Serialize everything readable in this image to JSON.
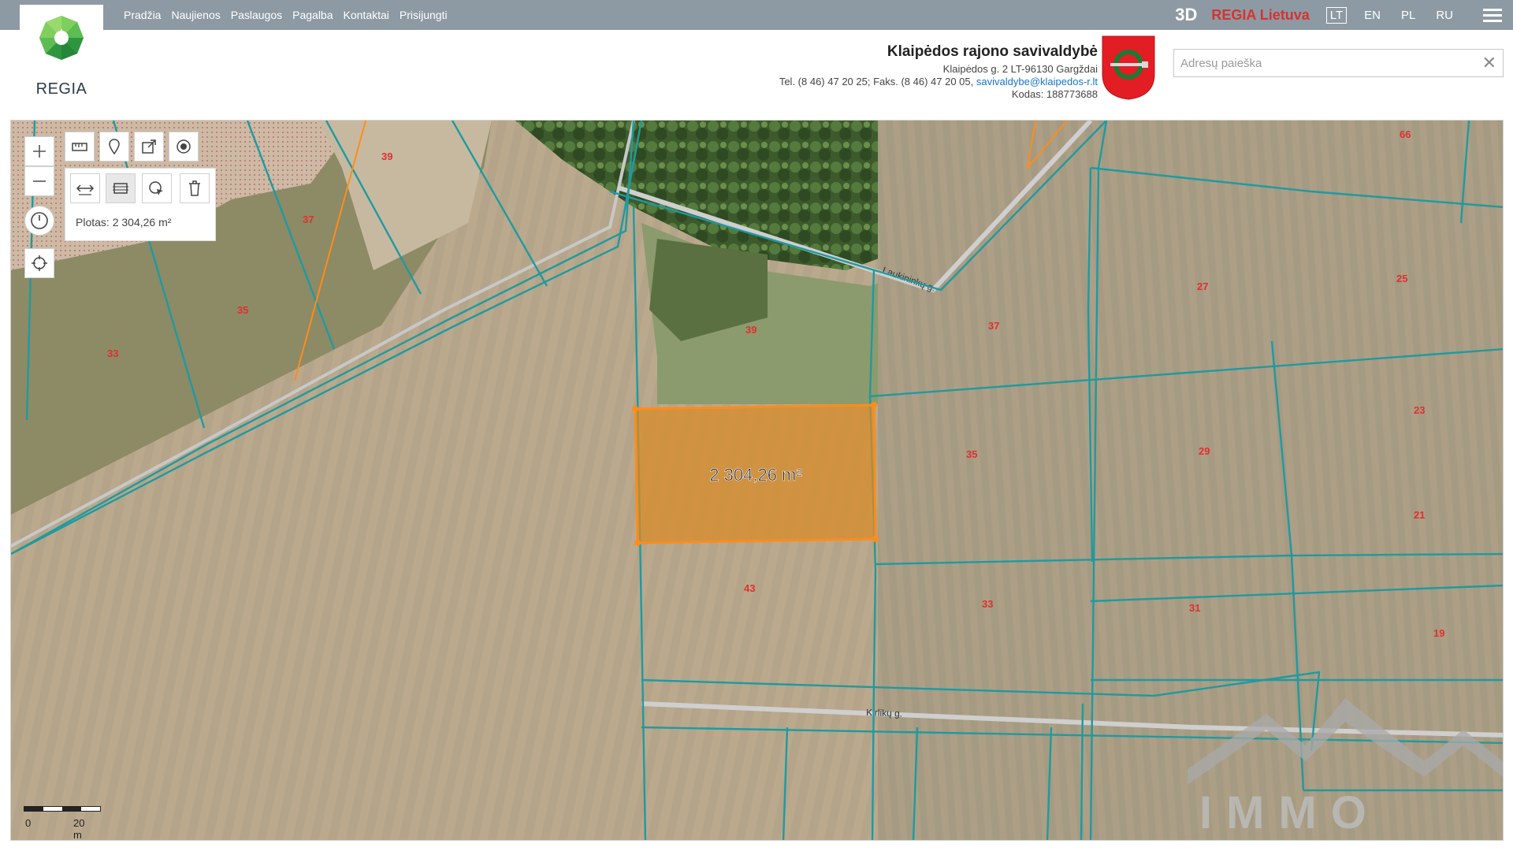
{
  "nav": {
    "items": [
      "Pradžia",
      "Naujienos",
      "Paslaugos",
      "Pagalba",
      "Kontaktai",
      "Prisijungti"
    ]
  },
  "topright": {
    "btn3d": "3D",
    "regia": "REGIA Lietuva",
    "languages": [
      "LT",
      "EN",
      "PL",
      "RU"
    ],
    "active_language": "LT"
  },
  "logo": {
    "text": "REGIA"
  },
  "municipality": {
    "name": "Klaipėdos rajono savivaldybė",
    "address": "Klaipėdos g. 2 LT-96130 Gargždai",
    "phones": "Tel. (8 46) 47 20 25; Faks. (8 46) 47 20 05,",
    "email": "savivaldybe@klaipedos-r.lt",
    "code": "Kodas: 188773688"
  },
  "search": {
    "placeholder": "Adresų paieška",
    "value": ""
  },
  "map": {
    "measure_result": "Plotas: 2 304,26 m²",
    "measured_area_label": "2 304,26 m²",
    "scale": {
      "zero": "0",
      "distance": "20 m"
    },
    "streets": [
      "Laukininkų g.",
      "Kirlikų g."
    ],
    "parcel_numbers": [
      "39",
      "37",
      "35",
      "33",
      "39",
      "37",
      "27",
      "25",
      "66",
      "35",
      "29",
      "23",
      "21",
      "43",
      "33",
      "31",
      "19"
    ],
    "watermark": "IMMO"
  },
  "colors": {
    "topbar": "#8e9aa3",
    "parcel_line": "#1f9aa0",
    "measure": "#ff8c1a",
    "accent_red": "#d6332f"
  }
}
